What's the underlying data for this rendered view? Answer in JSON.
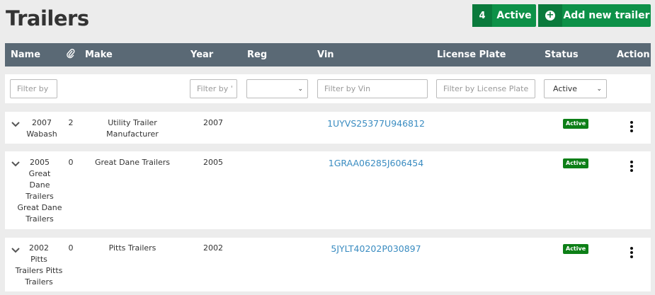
{
  "page": {
    "title": "Trailers"
  },
  "header_buttons": {
    "active_count": "4",
    "active_label": "Active",
    "add_label": "Add new trailer",
    "add_icon": "plus-circle-icon"
  },
  "columns": {
    "name": "Name",
    "make": "Make",
    "year": "Year",
    "reg": "Reg",
    "vin": "Vin",
    "license_plate": "License Plate",
    "status": "Status",
    "action": "Action",
    "attachment_icon": "paperclip-icon"
  },
  "filters": {
    "name_placeholder": "Filter by",
    "year_placeholder": "Filter by '",
    "reg_value": "",
    "vin_placeholder": "Filter by Vin",
    "license_placeholder": "Filter by License Plate",
    "status_value": "Active"
  },
  "rows": [
    {
      "name_l1": "2007",
      "name_l2": "Wabash",
      "name_l3": "",
      "name_l4": "",
      "name_l5": "",
      "attachments": "2",
      "make_l1": "Utility Trailer",
      "make_l2": "Manufacturer",
      "year": "2007",
      "vin": "1UYVS25377U946812",
      "status": "Active"
    },
    {
      "name_l1": "2005",
      "name_l2": "Great",
      "name_l3": "Dane",
      "name_l4": "Trailers",
      "name_l5": "Great Dane",
      "name_l6": "Trailers",
      "attachments": "0",
      "make_l1": "Great Dane Trailers",
      "make_l2": "",
      "year": "2005",
      "vin": "1GRAA06285J606454",
      "status": "Active"
    },
    {
      "name_l1": "2002",
      "name_l2": "Pitts",
      "name_l3": "Trailers Pitts",
      "name_l4": "Trailers",
      "name_l5": "",
      "attachments": "0",
      "make_l1": "Pitts Trailers",
      "make_l2": "",
      "year": "2002",
      "vin": "5JYLT40202P030897",
      "status": "Active"
    }
  ],
  "colors": {
    "accent": "#0d9148",
    "header_bg": "#5a6975",
    "badge": "#0d7f17",
    "link": "#3a8cc1"
  }
}
